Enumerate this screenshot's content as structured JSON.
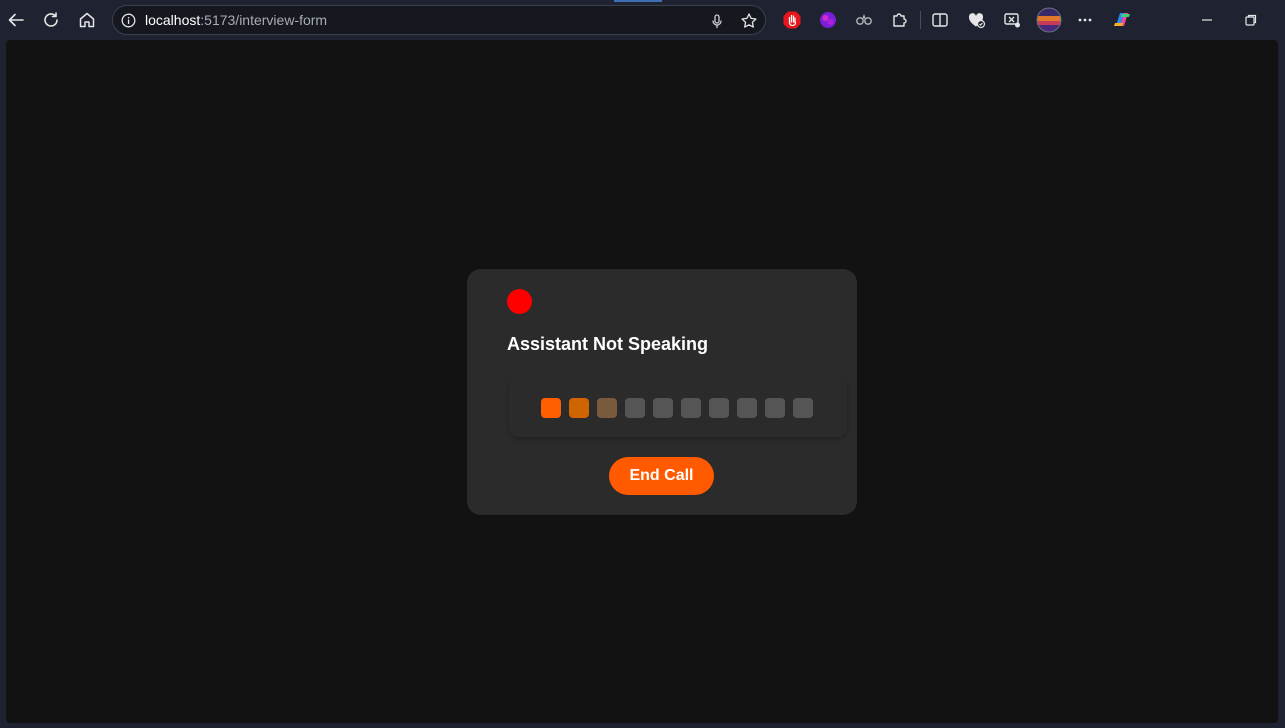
{
  "browser": {
    "url_host": "localhost",
    "url_rest": ":5173/interview-form",
    "icons": {
      "back": "back-arrow-icon",
      "refresh": "refresh-icon",
      "home": "home-icon",
      "info": "info-icon",
      "mic": "microphone-icon",
      "favorite": "star-icon",
      "ext1": "stop-hand-extension-icon",
      "ext2": "purple-extension-icon",
      "ext3": "link-extension-icon",
      "extensions": "puzzle-icon",
      "split": "split-screen-icon",
      "health": "browser-essentials-icon",
      "screenshot": "screenshot-icon",
      "profile": "profile-avatar",
      "more": "more-icon",
      "copilot": "copilot-icon",
      "minimize": "minimize-icon",
      "restore": "restore-icon"
    }
  },
  "call": {
    "status_color": "#ff0000",
    "title": "Assistant Not Speaking",
    "end_call_label": "End Call",
    "accent": "#ff5a00",
    "volume_bars": [
      "#ff5f00",
      "#cf6400",
      "#7a5a3e",
      "#555555",
      "#555555",
      "#555555",
      "#555555",
      "#555555",
      "#555555",
      "#555555"
    ]
  }
}
